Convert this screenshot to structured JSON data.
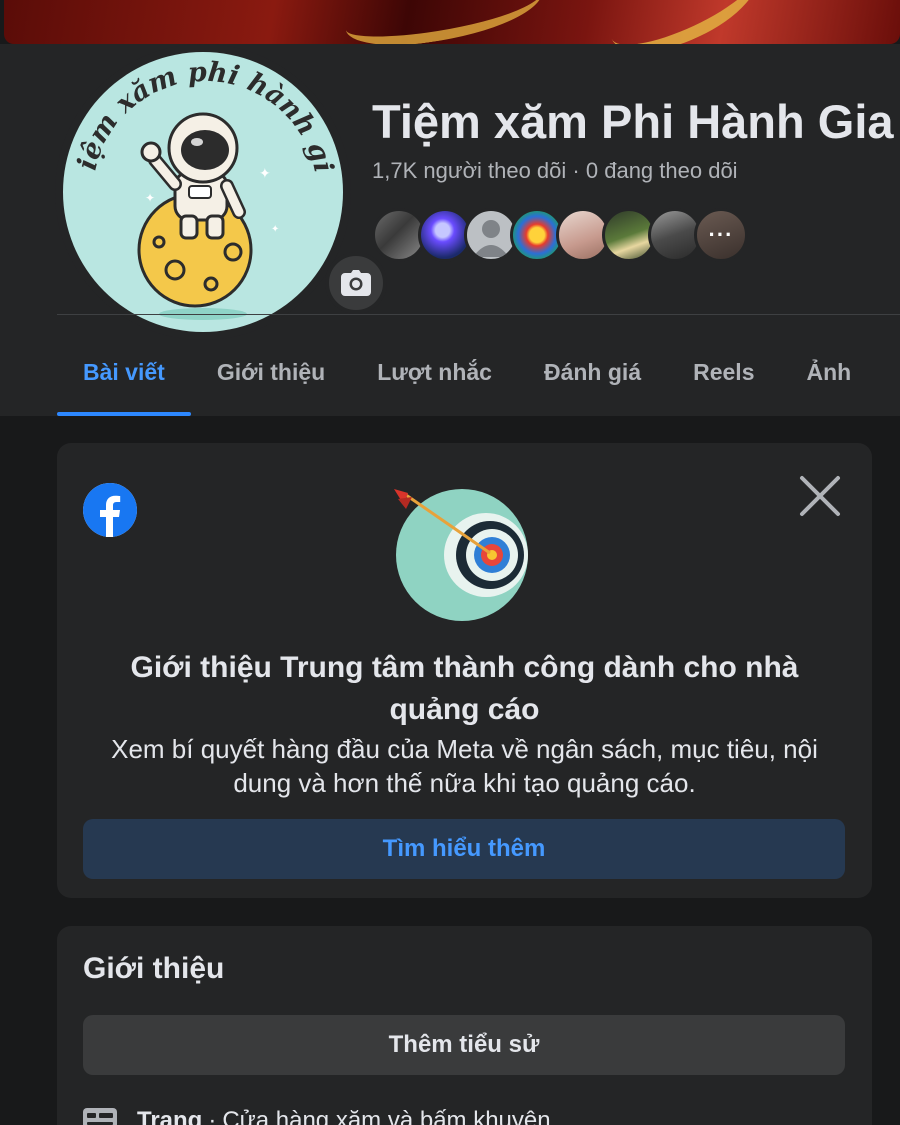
{
  "page": {
    "name": "Tiệm xăm Phi Hành Gia",
    "avatar_text": "Tiệm xăm phi hành gia",
    "followers": "1,7K người theo dõi",
    "separator": "·",
    "following": "0 đang theo dõi",
    "follower_avatar_more": "···"
  },
  "tabs": [
    {
      "label": "Bài viết",
      "active": true
    },
    {
      "label": "Giới thiệu"
    },
    {
      "label": "Lượt nhắc"
    },
    {
      "label": "Đánh giá"
    },
    {
      "label": "Reels"
    },
    {
      "label": "Ảnh"
    }
  ],
  "ad_card": {
    "title": "Giới thiệu Trung tâm thành công dành cho nhà quảng cáo",
    "description": "Xem bí quyết hàng đầu của Meta về ngân sách, mục tiêu, nội dung và hơn thế nữa khi tạo quảng cáo.",
    "button_label": "Tìm hiểu thêm"
  },
  "intro": {
    "title": "Giới thiệu",
    "bio_button_label": "Thêm tiểu sử",
    "page_label": "Trang",
    "page_separator": "·",
    "page_category": "Cửa hàng xăm và bấm khuyên"
  },
  "colors": {
    "background": "#18191a",
    "panel": "#242526",
    "accent": "#2d88ff",
    "button_blue_bg": "#263951"
  },
  "icons": [
    "camera-icon",
    "facebook-logo-icon",
    "close-icon",
    "target-icon",
    "page-flag-icon"
  ]
}
